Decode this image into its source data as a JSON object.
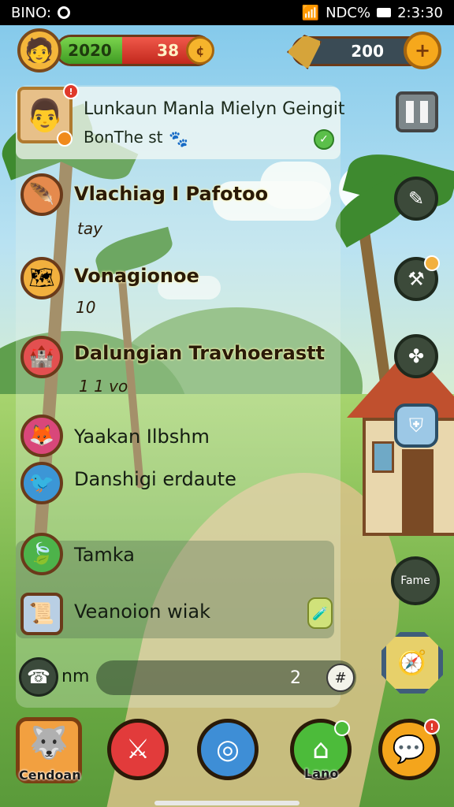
{
  "status_bar": {
    "left_text": "BINO:",
    "signal": "NDC%",
    "time": "2:3:30"
  },
  "hud": {
    "level": "2020",
    "health": "38",
    "gems": "200",
    "coin_icon": "coin-icon",
    "gem_plus_icon": "plus-icon"
  },
  "profile": {
    "name": "Lunkaun Manla Mielyn Geingit",
    "subtitle": "BonThe st"
  },
  "rows": [
    {
      "title": "Vlachiag I Pafotoo",
      "sub": "tay",
      "icon": "feather-icon",
      "color": "#e58a4d"
    },
    {
      "title": "Vonagionoe",
      "sub": "10",
      "icon": "map-icon",
      "color": "#f2b03e"
    },
    {
      "title": "Dalungian Travhoerastt",
      "sub": "1 1 vo",
      "icon": "castle-icon",
      "color": "#e35050"
    },
    {
      "title": "Yaakan Ilbshm",
      "sub": "",
      "icon": "fox-icon",
      "color": "#d9477a"
    },
    {
      "title": "Danshigi erdaute",
      "sub": "",
      "icon": "bird-icon",
      "color": "#3c96d6"
    },
    {
      "title": "Tamka",
      "sub": "",
      "icon": "leaf-icon",
      "color": "#4db34a"
    },
    {
      "title": "Veanoion wiak",
      "sub": "",
      "icon": "scroll-icon",
      "color": "#b9cfe4"
    }
  ],
  "input": {
    "label": "nm",
    "value": "2"
  },
  "side": {
    "fame_label": "Fame"
  },
  "nav": [
    {
      "label": "Cendoan",
      "icon": "wolf-icon"
    },
    {
      "label": "",
      "icon": "sword-icon"
    },
    {
      "label": "",
      "icon": "portal-icon"
    },
    {
      "label": "Lano",
      "icon": "house-icon"
    },
    {
      "label": "",
      "icon": "chat-icon"
    }
  ]
}
